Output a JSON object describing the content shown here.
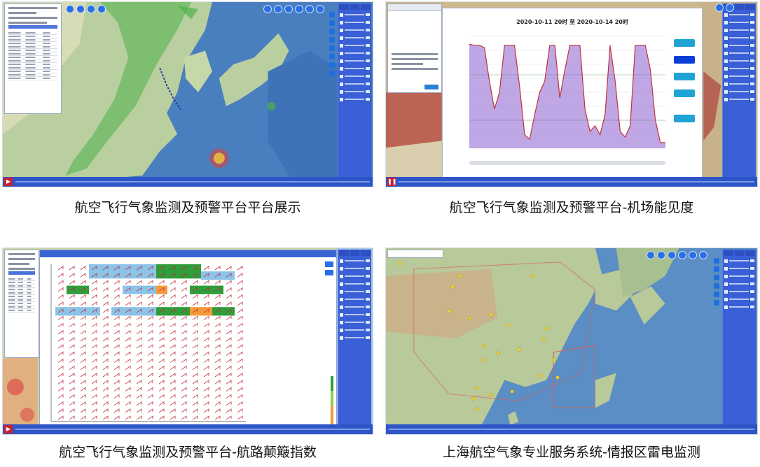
{
  "panels": [
    {
      "id": "p1",
      "caption": "航空飞行气象监测及预警平台平台展示"
    },
    {
      "id": "p2",
      "caption": "航空飞行气象监测及预警平台-机场能见度"
    },
    {
      "id": "p3",
      "caption": "航空飞行气象监测及预警平台-航路颠簸指数"
    },
    {
      "id": "p4",
      "caption": "上海航空气象专业服务系统-情报区雷电监测"
    }
  ],
  "visibility_chart": {
    "title": "2020-10-11 20时 至 2020-10-14 20时"
  },
  "colors": {
    "toolbar_blue": "#2a6fe6",
    "panel_blue": "#3a5fd6",
    "line_red": "#c0303a",
    "fill_purple": "#8a5fd0",
    "turb_green": "#2e9d3a",
    "turb_orange": "#f39a3a",
    "turb_blue": "#8cc3e8"
  },
  "chart_data": {
    "type": "area",
    "title": "2020-10-11 20时 至 2020-10-14 20时",
    "xlabel": "",
    "ylabel": "",
    "series": [
      {
        "values": [
          0.93,
          0.92,
          0.92,
          0.9,
          0.6,
          0.35,
          0.5,
          0.92,
          0.92,
          0.92,
          0.55,
          0.12,
          0.08,
          0.3,
          0.5,
          0.6,
          0.92,
          0.92,
          0.45,
          0.7,
          0.92,
          0.92,
          0.92,
          0.35,
          0.15,
          0.2,
          0.12,
          0.3,
          0.92,
          0.6,
          0.15,
          0.1,
          0.2,
          0.92,
          0.92,
          0.92,
          0.7,
          0.25,
          0.05,
          0.05
        ]
      }
    ]
  }
}
